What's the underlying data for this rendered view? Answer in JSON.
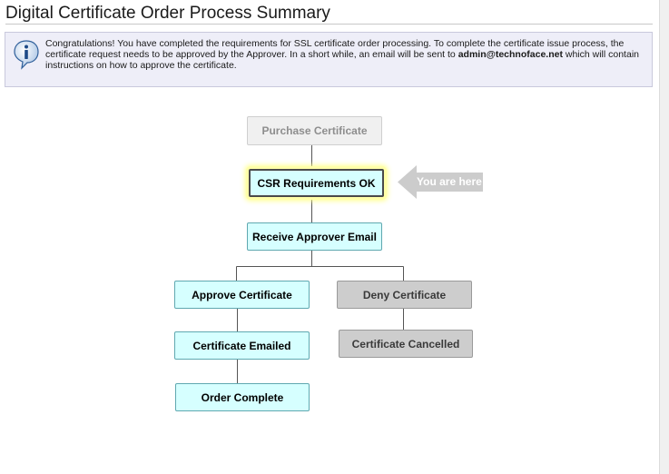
{
  "page": {
    "title": "Digital Certificate Order Process Summary"
  },
  "notice": {
    "icon": "info-icon",
    "text_before_email": "Congratulations! You have completed the requirements for SSL certificate order processing. To complete the certificate issue process, the certificate request needs to be approved by the Approver. In a short while, an email will be sent to ",
    "email": "admin@technoface.net",
    "text_after_email": " which will contain instructions on how to approve the certificate."
  },
  "flow": {
    "steps": {
      "purchase": "Purchase Certificate",
      "csr": "CSR Requirements OK",
      "receive_email": "Receive Approver Email",
      "approve": "Approve Certificate",
      "deny": "Deny Certificate",
      "emailed": "Certificate Emailed",
      "cancelled": "Certificate Cancelled",
      "complete": "Order Complete"
    },
    "current_step": "CSR Requirements OK",
    "you_are_here": "You are here"
  },
  "colors": {
    "done_fill": "#f0f0f0",
    "current_fill": "#d6ffff",
    "current_glow": "#ffff88",
    "pending_fill": "#d6ffff",
    "alternate_fill": "#cdcdcd",
    "marker": "#cccccc"
  }
}
